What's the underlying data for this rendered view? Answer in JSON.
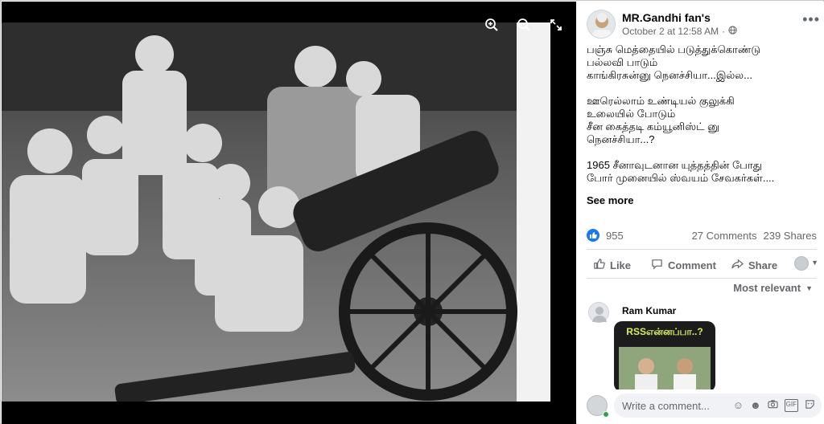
{
  "viewer": {
    "icons": [
      "zoom-in-icon",
      "zoom-out-icon",
      "expand-icon"
    ]
  },
  "post": {
    "author": "MR.Gandhi fan's",
    "timestamp": "October 2 at 12:58 AM",
    "privacy_icon": "globe-icon",
    "paragraphs": [
      [
        "பஞ்சு மெத்தையில் படுத்துக்கொண்டு",
        "பல்லவி பாடும்",
        "காங்கிரசுன்னு நெனச்சியா...இல்ல..."
      ],
      [
        "ஊரெல்லாம் உண்டியல் குலுக்கி",
        "உலையில் போடும்",
        "சீன கைத்தடி கம்யூனிஸ்ட் னு",
        "நெனச்சியா...?"
      ],
      [
        "1965 சீனாவுடனான யுத்தத்தின் போது",
        "போர் முனையில் ஸ்வயம் சேவகர்கள்...."
      ]
    ],
    "see_more": "See more",
    "like_count": "955",
    "comments_count": "27 Comments",
    "shares_count": "239 Shares",
    "actions": {
      "like": "Like",
      "comment": "Comment",
      "share": "Share"
    },
    "sort_label": "Most relevant"
  },
  "comments": [
    {
      "name": "Ram Kumar",
      "sticker_text": "RSSஎன்னப்பா..?"
    }
  ],
  "composer": {
    "placeholder": "Write a comment..."
  },
  "colors": {
    "accent": "#1877f2",
    "text": "#050505",
    "secondary": "#65676b"
  }
}
